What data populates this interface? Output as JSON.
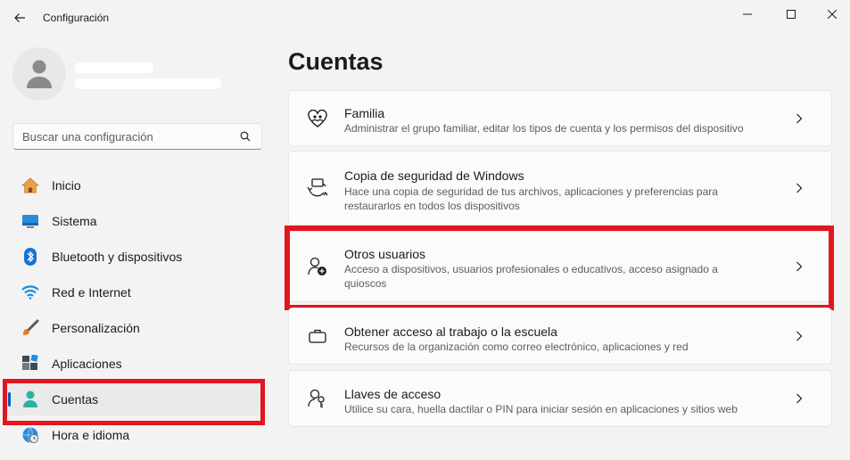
{
  "window": {
    "title": "Configuración"
  },
  "search": {
    "placeholder": "Buscar una configuración"
  },
  "sidebar": {
    "items": [
      {
        "label": "Inicio",
        "icon": "home-icon"
      },
      {
        "label": "Sistema",
        "icon": "monitor-icon"
      },
      {
        "label": "Bluetooth y dispositivos",
        "icon": "bluetooth-icon"
      },
      {
        "label": "Red e Internet",
        "icon": "wifi-icon"
      },
      {
        "label": "Personalización",
        "icon": "brush-icon"
      },
      {
        "label": "Aplicaciones",
        "icon": "apps-icon"
      },
      {
        "label": "Cuentas",
        "icon": "person-icon",
        "active": true
      },
      {
        "label": "Hora e idioma",
        "icon": "globe-clock-icon"
      }
    ]
  },
  "main": {
    "title": "Cuentas",
    "cards": [
      {
        "title": "Familia",
        "description": "Administrar el grupo familiar, editar los tipos de cuenta y los permisos del dispositivo",
        "icon": "heart-people-icon"
      },
      {
        "title": "Copia de seguridad de Windows",
        "description": "Hace una copia de seguridad de tus archivos, aplicaciones y preferencias para restaurarlos en todos los dispositivos",
        "icon": "backup-sync-icon"
      },
      {
        "title": "Otros usuarios",
        "description": "Acceso a dispositivos, usuarios profesionales o educativos, acceso asignado a quioscos",
        "icon": "add-person-icon"
      },
      {
        "title": "Obtener acceso al trabajo o la escuela",
        "description": "Recursos de la organización como correo electrónico, aplicaciones y red",
        "icon": "briefcase-icon"
      },
      {
        "title": "Llaves de acceso",
        "description": "Utilice su cara, huella dactilar o PIN para iniciar sesión en aplicaciones y sitios web",
        "icon": "passkey-icon"
      }
    ]
  },
  "colors": {
    "accent": "#005fb8",
    "highlight": "#e2161e",
    "background": "#f3f3f3",
    "card": "#fbfbfb"
  }
}
